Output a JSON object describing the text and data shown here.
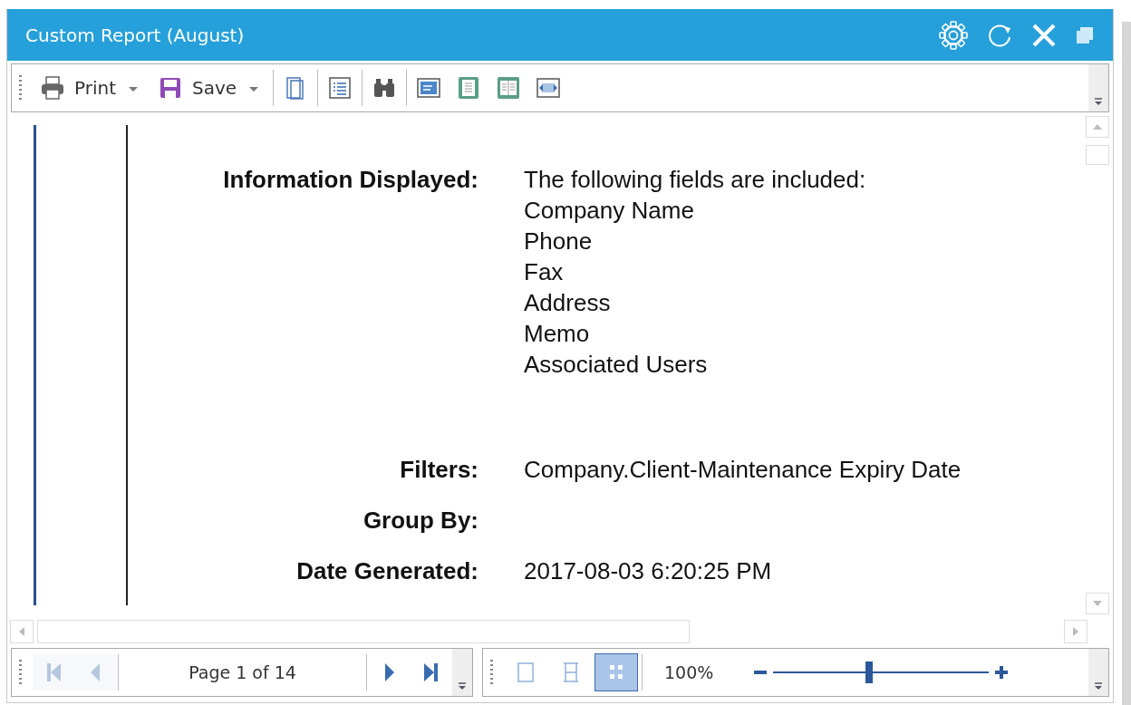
{
  "window": {
    "title": "Custom Report (August)"
  },
  "toolbar": {
    "items": [
      {
        "kind": "dropdown",
        "label": "Print"
      },
      {
        "kind": "dropdown",
        "label": "Save"
      },
      {
        "kind": "sep"
      },
      {
        "kind": "icon"
      },
      {
        "kind": "sep"
      },
      {
        "kind": "icon"
      },
      {
        "kind": "sep"
      },
      {
        "kind": "icon"
      },
      {
        "kind": "sep"
      },
      {
        "kind": "icon"
      },
      {
        "kind": "icon"
      },
      {
        "kind": "icon"
      },
      {
        "kind": "icon"
      }
    ]
  },
  "report": {
    "rows": [
      {
        "label": "Information Displayed:",
        "lines": [
          "The following fields are included:",
          "Company Name",
          "Phone",
          "Fax",
          "Address",
          "Memo",
          "Associated Users"
        ]
      },
      {
        "label": "Filters:",
        "lines": [
          "Company.Client-Maintenance Expiry Date"
        ]
      },
      {
        "label": "Group By:",
        "lines": []
      },
      {
        "label": "Date Generated:",
        "lines": [
          "2017-08-03 6:20:25 PM"
        ]
      }
    ]
  },
  "navigation": {
    "page_label": "Page 1 of 14",
    "first_enabled": false,
    "prev_enabled": false,
    "next_enabled": true,
    "last_enabled": true
  },
  "view_modes": [
    {
      "kind": "single",
      "selected": false
    },
    {
      "kind": "width",
      "selected": false
    },
    {
      "kind": "multi",
      "selected": true
    }
  ],
  "zoom": {
    "reading": "100%",
    "level": 0.445
  }
}
